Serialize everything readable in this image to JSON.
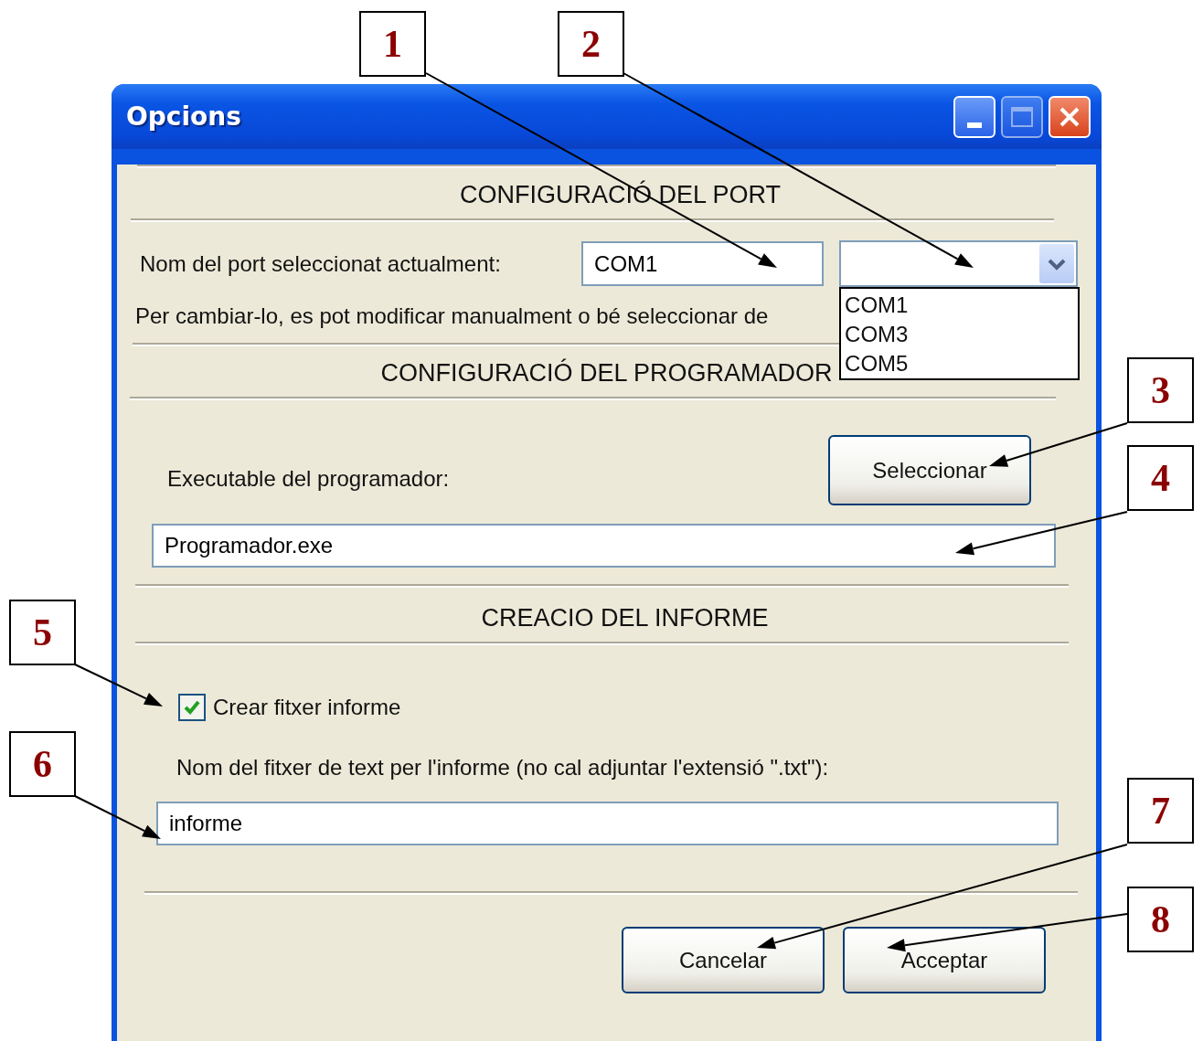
{
  "callouts": [
    {
      "number": "1"
    },
    {
      "number": "2"
    },
    {
      "number": "3"
    },
    {
      "number": "4"
    },
    {
      "number": "5"
    },
    {
      "number": "6"
    },
    {
      "number": "7"
    },
    {
      "number": "8"
    }
  ],
  "window": {
    "title": "Opcions"
  },
  "port_section": {
    "heading": "CONFIGURACIÓ DEL PORT",
    "label": "Nom del port seleccionat actualment:",
    "port_field": {
      "value": "COM1"
    },
    "port_dropdown": {
      "expanded": true,
      "options": [
        "COM1",
        "COM3",
        "COM5"
      ]
    },
    "hint": "Per cambiar-lo, es pot modificar manualment o bé seleccionar de"
  },
  "programmer_section": {
    "heading": "CONFIGURACIÓ DEL PROGRAMADOR",
    "label": "Executable del programador:",
    "select_button": "Seleccionar",
    "path_field": {
      "value": "Programador.exe"
    }
  },
  "report_section": {
    "heading": "CREACIO DEL INFORME",
    "checkbox": {
      "label": "Crear fitxer informe",
      "checked": true
    },
    "file_label": "Nom del fitxer de text per l'informe (no cal adjuntar l'extensió \".txt\"):",
    "file_field": {
      "value": "informe"
    }
  },
  "buttons": [
    "Cancelar",
    "Acceptar"
  ]
}
